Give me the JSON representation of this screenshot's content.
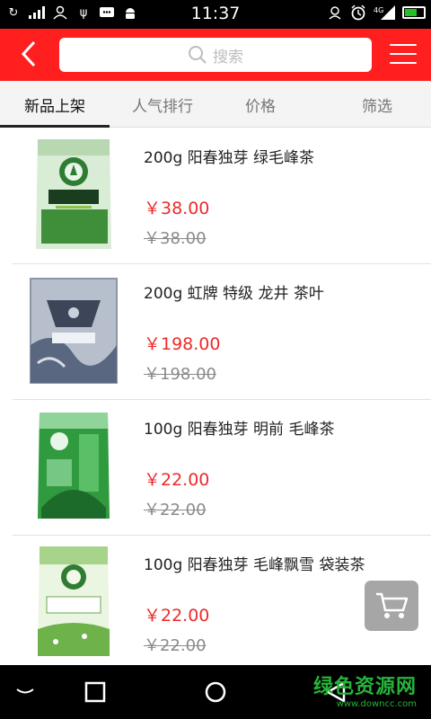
{
  "status_bar": {
    "time": "11:37",
    "network": "4G"
  },
  "header": {
    "search_placeholder": "搜索"
  },
  "tabs": [
    {
      "label": "新品上架",
      "active": true
    },
    {
      "label": "人气排行",
      "active": false
    },
    {
      "label": "价格",
      "active": false
    },
    {
      "label": "筛选",
      "active": false
    }
  ],
  "products": [
    {
      "name": "200g 阳春独芽 绿毛峰茶",
      "price": "￥38.00",
      "old_price": "￥38.00",
      "package": "green-pouch"
    },
    {
      "name": "200g 虹牌 特级 龙井 茶叶",
      "price": "￥198.00",
      "old_price": "￥198.00",
      "package": "gray-box"
    },
    {
      "name": "100g 阳春独芽 明前 毛峰茶",
      "price": "￥22.00",
      "old_price": "￥22.00",
      "package": "green-pouch-2"
    },
    {
      "name": "100g 阳春独芽 毛峰飘雪 袋装茶",
      "price": "￥22.00",
      "old_price": "￥22.00",
      "package": "light-green-pouch"
    }
  ],
  "colors": {
    "accent": "#ff1f1f",
    "price": "#ee2a2a",
    "watermark": "#27b33a"
  },
  "watermark": {
    "main": "绿色资源网",
    "sub": "www.downcc.com"
  }
}
